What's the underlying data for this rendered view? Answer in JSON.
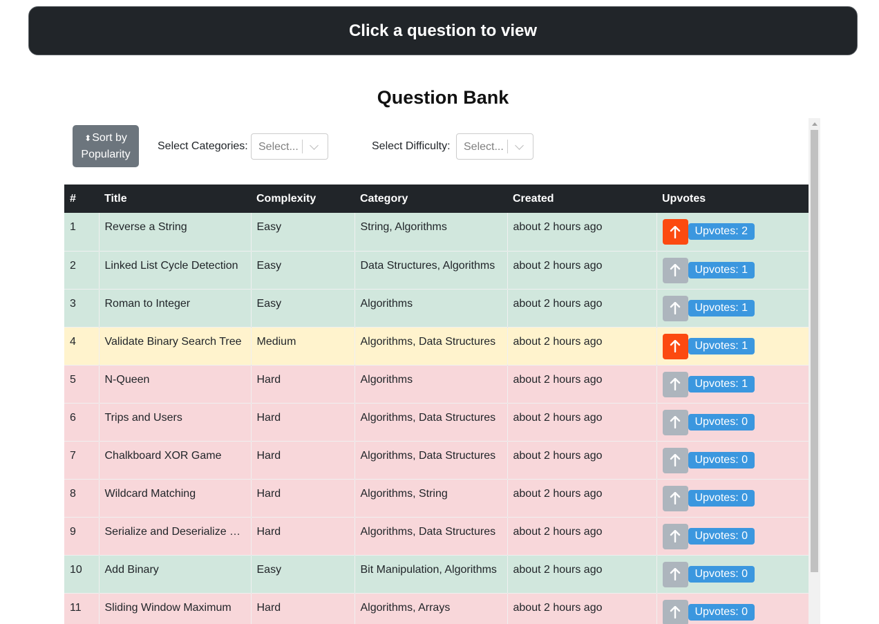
{
  "header": {
    "banner": "Click a question to view"
  },
  "page_title": "Question Bank",
  "controls": {
    "sort_label_line1": "Sort by",
    "sort_label_line2": "Popularity",
    "categories_label": "Select Categories:",
    "categories_placeholder": "Select...",
    "difficulty_label": "Select Difficulty:",
    "difficulty_placeholder": "Select..."
  },
  "table": {
    "headers": [
      "#",
      "Title",
      "Complexity",
      "Category",
      "Created",
      "Upvotes"
    ],
    "rows": [
      {
        "num": "1",
        "title": "Reverse a String",
        "complexity": "Easy",
        "category": "String, Algorithms",
        "created": "about 2 hours ago",
        "upvotes": "Upvotes: 2",
        "voted": true,
        "level": "easy"
      },
      {
        "num": "2",
        "title": "Linked List Cycle Detection",
        "complexity": "Easy",
        "category": "Data Structures, Algorithms",
        "created": "about 2 hours ago",
        "upvotes": "Upvotes: 1",
        "voted": false,
        "level": "easy"
      },
      {
        "num": "3",
        "title": "Roman to Integer",
        "complexity": "Easy",
        "category": "Algorithms",
        "created": "about 2 hours ago",
        "upvotes": "Upvotes: 1",
        "voted": false,
        "level": "easy"
      },
      {
        "num": "4",
        "title": "Validate Binary Search Tree",
        "complexity": "Medium",
        "category": "Algorithms, Data Structures",
        "created": "about 2 hours ago",
        "upvotes": "Upvotes: 1",
        "voted": true,
        "level": "medium"
      },
      {
        "num": "5",
        "title": "N-Queen",
        "complexity": "Hard",
        "category": "Algorithms",
        "created": "about 2 hours ago",
        "upvotes": "Upvotes: 1",
        "voted": false,
        "level": "hard"
      },
      {
        "num": "6",
        "title": "Trips and Users",
        "complexity": "Hard",
        "category": "Algorithms, Data Structures",
        "created": "about 2 hours ago",
        "upvotes": "Upvotes: 0",
        "voted": false,
        "level": "hard"
      },
      {
        "num": "7",
        "title": "Chalkboard XOR Game",
        "complexity": "Hard",
        "category": "Algorithms, Data Structures",
        "created": "about 2 hours ago",
        "upvotes": "Upvotes: 0",
        "voted": false,
        "level": "hard"
      },
      {
        "num": "8",
        "title": "Wildcard Matching",
        "complexity": "Hard",
        "category": "Algorithms, String",
        "created": "about 2 hours ago",
        "upvotes": "Upvotes: 0",
        "voted": false,
        "level": "hard"
      },
      {
        "num": "9",
        "title": "Serialize and Deserialize Bi...",
        "complexity": "Hard",
        "category": "Algorithms, Data Structures",
        "created": "about 2 hours ago",
        "upvotes": "Upvotes: 0",
        "voted": false,
        "level": "hard"
      },
      {
        "num": "10",
        "title": "Add Binary",
        "complexity": "Easy",
        "category": "Bit Manipulation, Algorithms",
        "created": "about 2 hours ago",
        "upvotes": "Upvotes: 0",
        "voted": false,
        "level": "easy"
      },
      {
        "num": "11",
        "title": "Sliding Window Maximum",
        "complexity": "Hard",
        "category": "Algorithms, Arrays",
        "created": "about 2 hours ago",
        "upvotes": "Upvotes: 0",
        "voted": false,
        "level": "hard"
      }
    ]
  },
  "colors": {
    "upvote_active": "#fc4a10",
    "upvote_inactive": "#adb5bd",
    "badge": "#3b97df",
    "easy_row": "#d1e7dd",
    "medium_row": "#fff3cd",
    "hard_row": "#f8d7da"
  },
  "icons": {
    "sort": "sort-icon",
    "upvote": "arrow-up-icon",
    "dropdown": "chevron-down-icon"
  }
}
